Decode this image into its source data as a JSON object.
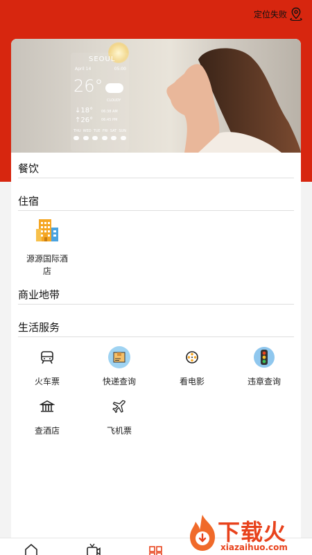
{
  "header": {
    "location_status": "定位失败"
  },
  "banner": {
    "weather": {
      "city": "SEOUL",
      "date": "April 14",
      "time": "05:00",
      "temperature": "26°",
      "condition": "CLOUDY",
      "low": "↓18°",
      "high": "↑26°",
      "sunrise": "06:38 AM",
      "sunset": "06:45 PM",
      "days": [
        "THU",
        "WED",
        "TUE",
        "FRI",
        "SAT",
        "SUN"
      ]
    }
  },
  "sections": {
    "dining": {
      "title": "餐饮"
    },
    "lodging": {
      "title": "住宿",
      "items": [
        {
          "label": "源源国际酒店",
          "icon": "hotel-building-icon"
        }
      ]
    },
    "commercial": {
      "title": "商业地带"
    },
    "services": {
      "title": "生活服务",
      "items": [
        {
          "label": "火车票",
          "icon": "train-icon"
        },
        {
          "label": "快递查询",
          "icon": "package-icon"
        },
        {
          "label": "看电影",
          "icon": "film-reel-icon"
        },
        {
          "label": "违章查询",
          "icon": "traffic-light-icon"
        },
        {
          "label": "查酒店",
          "icon": "bank-building-icon"
        },
        {
          "label": "飞机票",
          "icon": "airplane-icon"
        }
      ]
    }
  },
  "bottom_nav": {
    "items": [
      {
        "icon": "home-icon"
      },
      {
        "icon": "video-icon"
      },
      {
        "icon": "grid-icon",
        "active": true
      },
      {
        "icon": "user-icon"
      }
    ]
  },
  "watermark": {
    "brand": "下载火",
    "url": "xiazaihuo.com"
  },
  "colors": {
    "header_red": "#d7260f",
    "accent_orange": "#e8421c"
  }
}
